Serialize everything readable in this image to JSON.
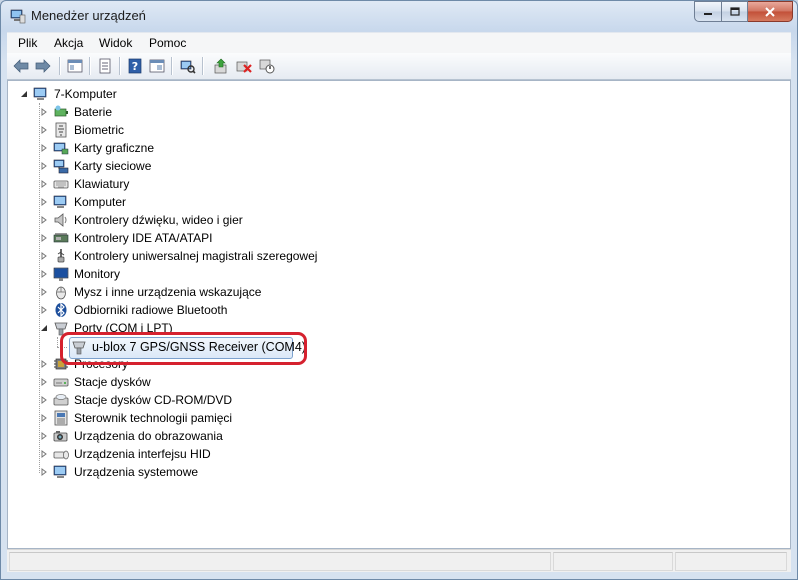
{
  "window": {
    "title": "Menedżer urządzeń"
  },
  "menu": [
    "Plik",
    "Akcja",
    "Widok",
    "Pomoc"
  ],
  "toolbar": {
    "buttons": [
      "back-icon",
      "forward-icon",
      "show-hide-console-tree-icon",
      "properties-icon",
      "help-icon",
      "scan-hardware-icon",
      "update-driver-icon",
      "uninstall-icon",
      "disable-icon"
    ]
  },
  "tree": {
    "root": "7-Komputer",
    "categories": [
      "Baterie",
      "Biometric",
      "Karty graficzne",
      "Karty sieciowe",
      "Klawiatury",
      "Komputer",
      "Kontrolery dźwięku, wideo i gier",
      "Kontrolery IDE ATA/ATAPI",
      "Kontrolery uniwersalnej magistrali szeregowej",
      "Monitory",
      "Mysz i inne urządzenia wskazujące",
      "Odbiorniki radiowe Bluetooth",
      "Porty (COM i LPT)",
      "Procesory",
      "Stacje dysków",
      "Stacje dysków CD-ROM/DVD",
      "Sterownik technologii pamięci",
      "Urządzenia do obrazowania",
      "Urządzenia interfejsu HID",
      "Urządzenia systemowe"
    ],
    "expanded_child": "u-blox 7 GPS/GNSS Receiver (COM4)"
  },
  "colors": {
    "highlight": "#d5212e",
    "selection": "#dbe8f7"
  }
}
